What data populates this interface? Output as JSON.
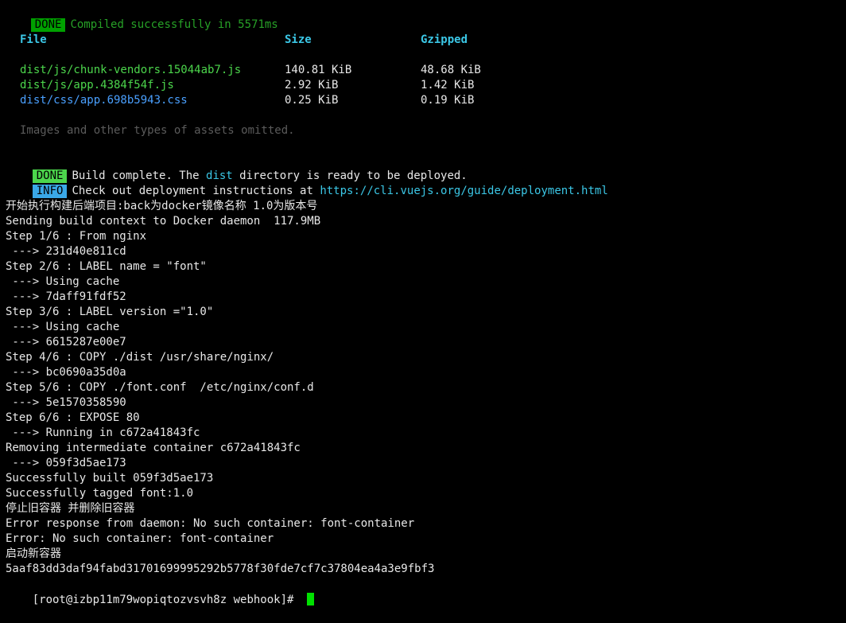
{
  "build": {
    "compiled_badge": "DONE",
    "compiled_text": "Compiled successfully in 5571ms",
    "table": {
      "headers": [
        "File",
        "Size",
        "Gzipped"
      ],
      "rows": [
        {
          "file": "dist/js/chunk-vendors.15044ab7.js",
          "size": "140.81 KiB",
          "gzipped": "48.68 KiB"
        },
        {
          "file": "dist/js/app.4384f54f.js",
          "size": "2.92 KiB",
          "gzipped": "1.42 KiB"
        },
        {
          "file": "dist/css/app.698b5943.css",
          "size": "0.25 KiB",
          "gzipped": "0.19 KiB"
        }
      ],
      "omitted_note": "Images and other types of assets omitted."
    },
    "done_badge": "DONE",
    "done_text_1": "Build complete. The ",
    "done_dist": "dist",
    "done_text_2": " directory is ready to be deployed.",
    "info_badge": "INFO",
    "info_text": "Check out deployment instructions at ",
    "info_url": "https://cli.vuejs.org/guide/deployment.html"
  },
  "log_lines": [
    "开始执行构建后端项目:back为docker镜像名称 1.0为版本号",
    "Sending build context to Docker daemon  117.9MB",
    "Step 1/6 : From nginx",
    " ---> 231d40e811cd",
    "Step 2/6 : LABEL name = \"font\"",
    " ---> Using cache",
    " ---> 7daff91fdf52",
    "Step 3/6 : LABEL version =\"1.0\"",
    " ---> Using cache",
    " ---> 6615287e00e7",
    "Step 4/6 : COPY ./dist /usr/share/nginx/",
    " ---> bc0690a35d0a",
    "Step 5/6 : COPY ./font.conf  /etc/nginx/conf.d",
    " ---> 5e1570358590",
    "Step 6/6 : EXPOSE 80",
    " ---> Running in c672a41843fc",
    "Removing intermediate container c672a41843fc",
    " ---> 059f3d5ae173",
    "Successfully built 059f3d5ae173",
    "Successfully tagged font:1.0",
    "停止旧容器 并删除旧容器",
    "Error response from daemon: No such container: font-container",
    "Error: No such container: font-container",
    "启动新容器",
    "5aaf83dd3daf94fabd31701699995292b5778f30fde7cf7c37804ea4a3e9fbf3"
  ],
  "prompt": "[root@izbp11m79wopiqtozvsvh8z webhook]# ",
  "colors": {
    "background": "#000000",
    "text": "#d8d8d8",
    "green": "#4cd64c",
    "cyan": "#3bc7e6",
    "blue": "#4aa0ff",
    "gray": "#5b5b5b",
    "cursor": "#00e000"
  }
}
